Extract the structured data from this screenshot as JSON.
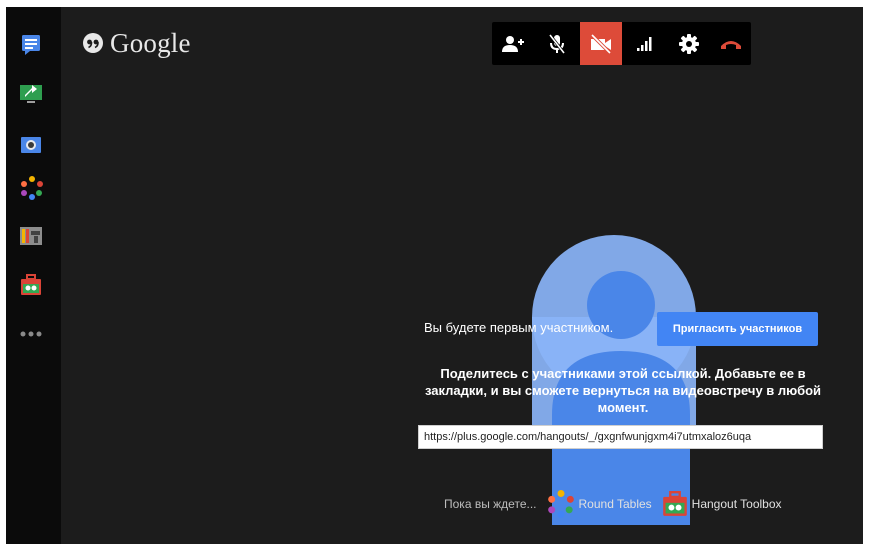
{
  "app": {
    "logo_text": "Google"
  },
  "sidebar": {
    "items": [
      {
        "name": "chat",
        "icon": "chat-icon",
        "color": "#4a86e8"
      },
      {
        "name": "screenshare",
        "icon": "screenshare-icon",
        "color": "#34a853"
      },
      {
        "name": "capture",
        "icon": "camera-icon",
        "color": "#4a86e8"
      },
      {
        "name": "round-tables",
        "icon": "round-tables-icon",
        "color": "#f4b400"
      },
      {
        "name": "control-room",
        "icon": "control-room-icon",
        "color": "#9e9e9e"
      },
      {
        "name": "hangout-toolbox",
        "icon": "toolbox-icon",
        "color": "#db4437"
      },
      {
        "name": "more",
        "icon": "more-dots-icon",
        "color": "#8a8a8a"
      }
    ]
  },
  "toolbar": {
    "buttons": [
      {
        "name": "invite-people",
        "icon": "add-person-icon"
      },
      {
        "name": "mute-mic",
        "icon": "mic-off-icon"
      },
      {
        "name": "camera-off",
        "icon": "camera-off-icon",
        "active": true,
        "color": "#dd4b39"
      },
      {
        "name": "bandwidth",
        "icon": "signal-bars-icon"
      },
      {
        "name": "settings",
        "icon": "gear-icon"
      },
      {
        "name": "hang-up",
        "icon": "hangup-icon",
        "color": "#dd4b39"
      }
    ]
  },
  "main": {
    "first_participant": "Вы будете первым участником.",
    "invite_button": "Пригласить участников",
    "share_text": "Поделитесь с участниками этой ссылкой. Добавьте ее в закладки, и вы сможете вернуться на видеовстречу в любой момент.",
    "link_value": "https://plus.google.com/hangouts/_/gxgnfwunjgxm4i7utmxaloz6uqa"
  },
  "footer": {
    "waiting": "Пока вы ждете...",
    "apps": [
      {
        "label": "Round Tables",
        "icon": "round-tables-icon"
      },
      {
        "label": "Hangout Toolbox",
        "icon": "toolbox-icon"
      }
    ]
  },
  "colors": {
    "background": "#1c1c1c",
    "rail": "#0b0b0b",
    "accent_blue": "#4285f4",
    "avatar_light": "#8ab4f8",
    "avatar_dark": "#4a86e8",
    "red": "#dd4b39"
  }
}
